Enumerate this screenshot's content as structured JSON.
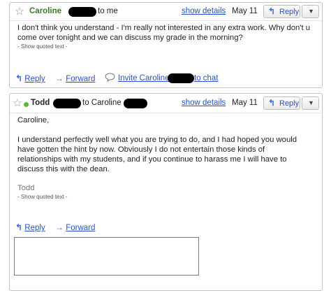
{
  "message1": {
    "sender": "Caroline",
    "to_label": "to me",
    "show_details": "show details",
    "date": "May 11",
    "reply_label": "Reply",
    "body": "I don't think you understand - I'm really not interested in any extra work.  Why don't u come over tonight and we can discuss my grade in the morning?",
    "quoted": "- Show quoted text -",
    "actions": {
      "reply": "Reply",
      "forward": "Forward",
      "invite_prefix": "Invite Caroline",
      "invite_suffix": "to chat"
    }
  },
  "message2": {
    "sender": "Todd",
    "to_label": "to Caroline",
    "show_details": "show details",
    "date": "May 11",
    "reply_label": "Reply",
    "greeting": "Caroline,",
    "body": "I understand perfectly well what you are trying to do, and I had hoped you would have gotten the hint by now.  Obviously I do not entertain those kinds of relationships with my students, and if you continue to harass me I will have to discuss this with the dean.",
    "signature": "Todd",
    "quoted": "- Show quoted text -",
    "actions": {
      "reply": "Reply",
      "forward": "Forward"
    }
  },
  "colors": {
    "link": "#2a4fc7",
    "sender_green": "#3a7a2c",
    "presence_dot": "#5cb832"
  },
  "icons": [
    "reply-arrow-icon",
    "forward-arrow-icon",
    "chat-bubble-icon",
    "dropdown-arrow-icon",
    "presence-dot-icon"
  ]
}
